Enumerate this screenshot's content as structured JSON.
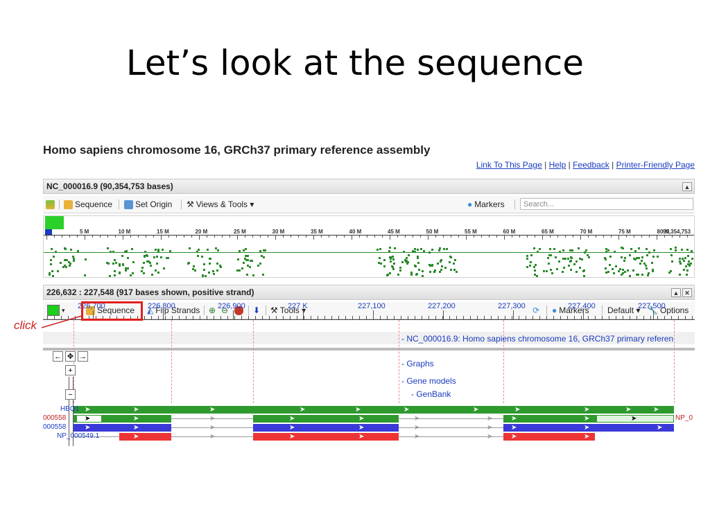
{
  "slide": {
    "title": "Let’s look at the sequence"
  },
  "viewer": {
    "heading": "Homo sapiens chromosome 16, GRCh37 primary reference assembly",
    "links": [
      "Link To This Page",
      "Help",
      "Feedback",
      "Printer-Friendly Page"
    ],
    "link_sep": "|",
    "overview_panel": {
      "title": "NC_000016.9 (90,354,753 bases)",
      "toolbar": {
        "sequence": "Sequence",
        "set_origin": "Set Origin",
        "views_tools": "Views & Tools ▾",
        "markers": "Markers",
        "search_placeholder": "Search..."
      },
      "ruler": [
        "5 M",
        "10 M",
        "15 M",
        "20 M",
        "25 M",
        "30 M",
        "35 M",
        "40 M",
        "45 M",
        "50 M",
        "55 M",
        "60 M",
        "65 M",
        "70 M",
        "75 M",
        "80 M",
        "90,354,753"
      ]
    },
    "detail_panel": {
      "title": "226,632 : 227,548 (917 bases shown, positive strand)",
      "toolbar": {
        "sequence": "Sequence",
        "flip_strands": "Flip Strands",
        "tools": "Tools ▾",
        "markers": "Markers",
        "default": "Default ▾",
        "options": "Options"
      },
      "axis": [
        "226,700",
        "226,800",
        "226,900",
        "227 K",
        "227,100",
        "227,200",
        "227,300",
        "227,400",
        "227,500"
      ],
      "tracks": {
        "sequence_track": "- NC_000016.9: Homo sapiens chromosome 16, GRCh37 primary referen",
        "graphs": "- Graphs",
        "gene_models": "- Gene models",
        "genbank": "- GenBank"
      },
      "features": {
        "gene": "HBQ1",
        "mrna": "000558",
        "mrna2": "000558",
        "protein": "NP_000549.1",
        "mrna_right": "NP_0"
      }
    }
  },
  "annotation": {
    "click": "click"
  },
  "colors": {
    "green": "#2a8a2a",
    "blue": "#3a3ad8",
    "red": "#ee3535",
    "highlight": "#e0201f"
  }
}
